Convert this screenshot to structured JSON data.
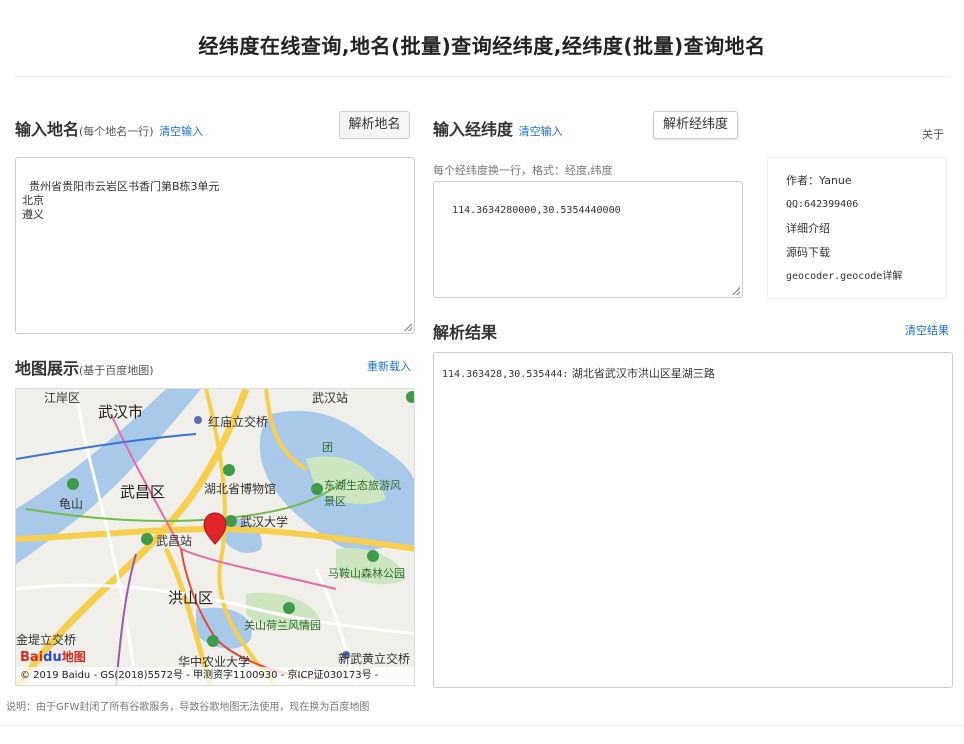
{
  "page": {
    "title": "经纬度在线查询,地名(批量)查询经纬度,经纬度(批量)查询地名"
  },
  "geocode": {
    "title": "输入地名",
    "hint": "(每个地名一行)",
    "clear_link": "清空输入",
    "parse_button": "解析地名",
    "input_value": "贵州省贵阳市云岩区书香门第B栋3单元\n北京\n遵义"
  },
  "reverse": {
    "title": "输入经纬度",
    "clear_link": "清空输入",
    "parse_button": "解析经纬度",
    "hint": "每个经纬度换一行，格式：经度,纬度",
    "input_value": "114.3634280000,30.5354440000"
  },
  "about": {
    "label": "关于",
    "author": "作者：Yanue",
    "qq": "QQ:642399406",
    "detail_link": "详细介绍",
    "source_link": "源码下载",
    "doc_link": "geocoder.geocode详解"
  },
  "map": {
    "title": "地图展示",
    "hint": "(基于百度地图)",
    "reload_link": "重新载入",
    "labels": {
      "jiangan": "江岸区",
      "wuhan_city": "武汉市",
      "hongmiao": "红庙立交桥",
      "wuhan_station": "武汉站",
      "museum": "湖北省博物馆",
      "wuchang_dist": "武昌区",
      "guishan": "龟山",
      "east_lake": "东湖生态旅游风景区",
      "whu": "武汉大学",
      "wuchang_station": "武昌站",
      "maanshan": "马鞍山森林公园",
      "hongshan": "洪山区",
      "guanshan": "关山荷兰风情园",
      "hzau": "华中农业大学",
      "diti": "金堤立交桥",
      "xinwu": "新武黄立交桥",
      "tuan": "团"
    },
    "logo_text": "Bai",
    "logo_paw": "du",
    "logo_cn": "地图",
    "footer": "© 2019 Baidu - GS(2018)5572号 - 甲测资字1100930 - 京ICP证030173号 -"
  },
  "result": {
    "title": "解析结果",
    "clear_link": "清空结果",
    "coord": "114.363428,30.535444:",
    "address": " 湖北省武汉市洪山区星湖三路"
  },
  "note": "说明：由于GFW封闭了所有谷歌服务，导致谷歌地图无法使用，现在换为百度地图",
  "colors": {
    "link": "#1a6fd1",
    "marker": "#e0262b",
    "water": "#a9c9ea",
    "park": "#cde6c1",
    "road_yellow": "#f6cf4e"
  }
}
